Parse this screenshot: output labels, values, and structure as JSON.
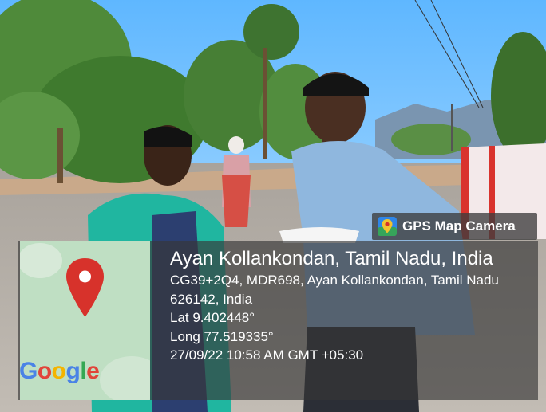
{
  "badge": {
    "icon": "map-pin-app-icon",
    "label": "GPS Map Camera"
  },
  "location": {
    "title": "Ayan Kollankondan, Tamil Nadu, India",
    "address": "CG39+2Q4, MDR698, Ayan Kollankondan, Tamil Nadu 626142, India",
    "lat": "Lat 9.402448°",
    "long": "Long 77.519335°",
    "timestamp": "27/09/22 10:58 AM GMT +05:30"
  },
  "map": {
    "marker": "map-pin-icon",
    "logo": "Google"
  },
  "colors": {
    "pin": "#d7322b",
    "logo_blue": "#4a83e6",
    "logo_red": "#e1453a",
    "logo_yellow": "#f4b400",
    "logo_green": "#34a853"
  }
}
